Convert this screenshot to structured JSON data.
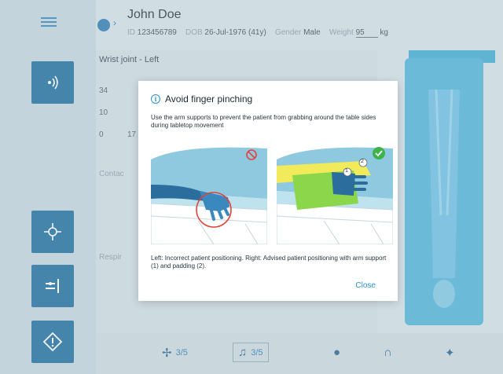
{
  "header": {
    "patient_name": "John Doe",
    "id_label": "ID",
    "id_value": "123456789",
    "dob_label": "DOB",
    "dob_value": "26-Jul-1976 (41y)",
    "gender_label": "Gender",
    "gender_value": "Male",
    "weight_label": "Weight",
    "weight_value": "95",
    "weight_unit": "kg"
  },
  "detail": {
    "joint_title": "Wrist joint - Left",
    "rows": [
      "34",
      "10",
      "0",
      "17"
    ],
    "label_a": "Contac",
    "label_b": "Respir"
  },
  "toolbar": {
    "fan_count": "3/5",
    "music_count": "3/5"
  },
  "modal": {
    "title": "Avoid finger pinching",
    "body": "Use the arm supports to prevent the patient from grabbing around the table sides during tabletop movement",
    "caption": "Left: Incorrect patient positioning. Right: Advised patient positioning with arm support (1) and padding (2).",
    "close_label": "Close",
    "marker_1": "1",
    "marker_2": "2"
  },
  "colors": {
    "accent": "#1b6a9a",
    "link": "#2c8fd0",
    "error": "#e2433a",
    "success": "#3db34a",
    "table": "#4db0d6"
  }
}
